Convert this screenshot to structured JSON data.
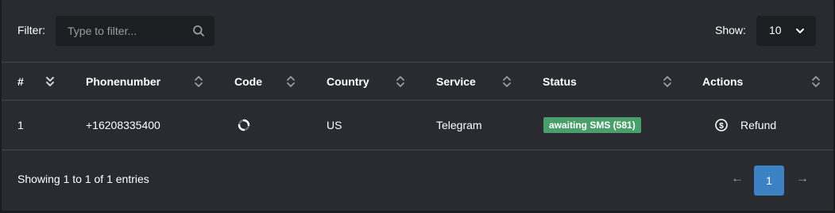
{
  "filter": {
    "label": "Filter:",
    "placeholder": "Type to filter...",
    "value": ""
  },
  "show": {
    "label": "Show:",
    "selected": "10"
  },
  "table": {
    "columns": [
      "#",
      "Phonenumber",
      "Code",
      "Country",
      "Service",
      "Status",
      "Actions"
    ],
    "rows": [
      {
        "index": "1",
        "phone": "+16208335400",
        "code_icon": "loading-spinner-icon",
        "country": "US",
        "service": "Telegram",
        "status": "awaiting SMS (581)",
        "action": "Refund",
        "action_icon": "dollar-circle-icon"
      }
    ]
  },
  "footer": {
    "entries_text": "Showing 1 to 1 of 1 entries",
    "prev": "←",
    "current_page": "1",
    "next": "→"
  },
  "colors": {
    "panel": "#2a2b30",
    "status_badge": "#4a9e6a",
    "active_page": "#3b82c4"
  }
}
